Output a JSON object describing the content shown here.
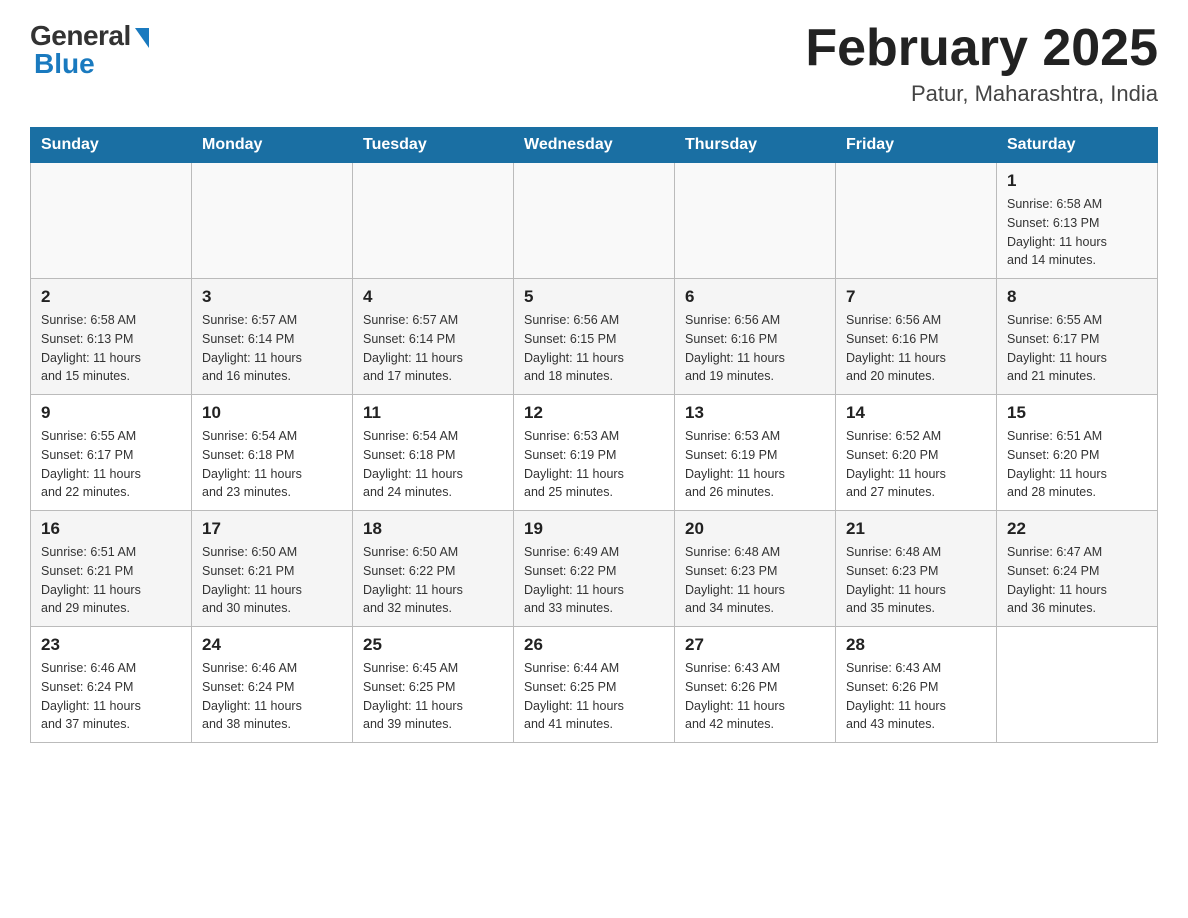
{
  "header": {
    "logo_general": "General",
    "logo_blue": "Blue",
    "month_title": "February 2025",
    "location": "Patur, Maharashtra, India"
  },
  "days_of_week": [
    "Sunday",
    "Monday",
    "Tuesday",
    "Wednesday",
    "Thursday",
    "Friday",
    "Saturday"
  ],
  "weeks": [
    [
      {
        "day": "",
        "info": ""
      },
      {
        "day": "",
        "info": ""
      },
      {
        "day": "",
        "info": ""
      },
      {
        "day": "",
        "info": ""
      },
      {
        "day": "",
        "info": ""
      },
      {
        "day": "",
        "info": ""
      },
      {
        "day": "1",
        "info": "Sunrise: 6:58 AM\nSunset: 6:13 PM\nDaylight: 11 hours\nand 14 minutes."
      }
    ],
    [
      {
        "day": "2",
        "info": "Sunrise: 6:58 AM\nSunset: 6:13 PM\nDaylight: 11 hours\nand 15 minutes."
      },
      {
        "day": "3",
        "info": "Sunrise: 6:57 AM\nSunset: 6:14 PM\nDaylight: 11 hours\nand 16 minutes."
      },
      {
        "day": "4",
        "info": "Sunrise: 6:57 AM\nSunset: 6:14 PM\nDaylight: 11 hours\nand 17 minutes."
      },
      {
        "day": "5",
        "info": "Sunrise: 6:56 AM\nSunset: 6:15 PM\nDaylight: 11 hours\nand 18 minutes."
      },
      {
        "day": "6",
        "info": "Sunrise: 6:56 AM\nSunset: 6:16 PM\nDaylight: 11 hours\nand 19 minutes."
      },
      {
        "day": "7",
        "info": "Sunrise: 6:56 AM\nSunset: 6:16 PM\nDaylight: 11 hours\nand 20 minutes."
      },
      {
        "day": "8",
        "info": "Sunrise: 6:55 AM\nSunset: 6:17 PM\nDaylight: 11 hours\nand 21 minutes."
      }
    ],
    [
      {
        "day": "9",
        "info": "Sunrise: 6:55 AM\nSunset: 6:17 PM\nDaylight: 11 hours\nand 22 minutes."
      },
      {
        "day": "10",
        "info": "Sunrise: 6:54 AM\nSunset: 6:18 PM\nDaylight: 11 hours\nand 23 minutes."
      },
      {
        "day": "11",
        "info": "Sunrise: 6:54 AM\nSunset: 6:18 PM\nDaylight: 11 hours\nand 24 minutes."
      },
      {
        "day": "12",
        "info": "Sunrise: 6:53 AM\nSunset: 6:19 PM\nDaylight: 11 hours\nand 25 minutes."
      },
      {
        "day": "13",
        "info": "Sunrise: 6:53 AM\nSunset: 6:19 PM\nDaylight: 11 hours\nand 26 minutes."
      },
      {
        "day": "14",
        "info": "Sunrise: 6:52 AM\nSunset: 6:20 PM\nDaylight: 11 hours\nand 27 minutes."
      },
      {
        "day": "15",
        "info": "Sunrise: 6:51 AM\nSunset: 6:20 PM\nDaylight: 11 hours\nand 28 minutes."
      }
    ],
    [
      {
        "day": "16",
        "info": "Sunrise: 6:51 AM\nSunset: 6:21 PM\nDaylight: 11 hours\nand 29 minutes."
      },
      {
        "day": "17",
        "info": "Sunrise: 6:50 AM\nSunset: 6:21 PM\nDaylight: 11 hours\nand 30 minutes."
      },
      {
        "day": "18",
        "info": "Sunrise: 6:50 AM\nSunset: 6:22 PM\nDaylight: 11 hours\nand 32 minutes."
      },
      {
        "day": "19",
        "info": "Sunrise: 6:49 AM\nSunset: 6:22 PM\nDaylight: 11 hours\nand 33 minutes."
      },
      {
        "day": "20",
        "info": "Sunrise: 6:48 AM\nSunset: 6:23 PM\nDaylight: 11 hours\nand 34 minutes."
      },
      {
        "day": "21",
        "info": "Sunrise: 6:48 AM\nSunset: 6:23 PM\nDaylight: 11 hours\nand 35 minutes."
      },
      {
        "day": "22",
        "info": "Sunrise: 6:47 AM\nSunset: 6:24 PM\nDaylight: 11 hours\nand 36 minutes."
      }
    ],
    [
      {
        "day": "23",
        "info": "Sunrise: 6:46 AM\nSunset: 6:24 PM\nDaylight: 11 hours\nand 37 minutes."
      },
      {
        "day": "24",
        "info": "Sunrise: 6:46 AM\nSunset: 6:24 PM\nDaylight: 11 hours\nand 38 minutes."
      },
      {
        "day": "25",
        "info": "Sunrise: 6:45 AM\nSunset: 6:25 PM\nDaylight: 11 hours\nand 39 minutes."
      },
      {
        "day": "26",
        "info": "Sunrise: 6:44 AM\nSunset: 6:25 PM\nDaylight: 11 hours\nand 41 minutes."
      },
      {
        "day": "27",
        "info": "Sunrise: 6:43 AM\nSunset: 6:26 PM\nDaylight: 11 hours\nand 42 minutes."
      },
      {
        "day": "28",
        "info": "Sunrise: 6:43 AM\nSunset: 6:26 PM\nDaylight: 11 hours\nand 43 minutes."
      },
      {
        "day": "",
        "info": ""
      }
    ]
  ]
}
